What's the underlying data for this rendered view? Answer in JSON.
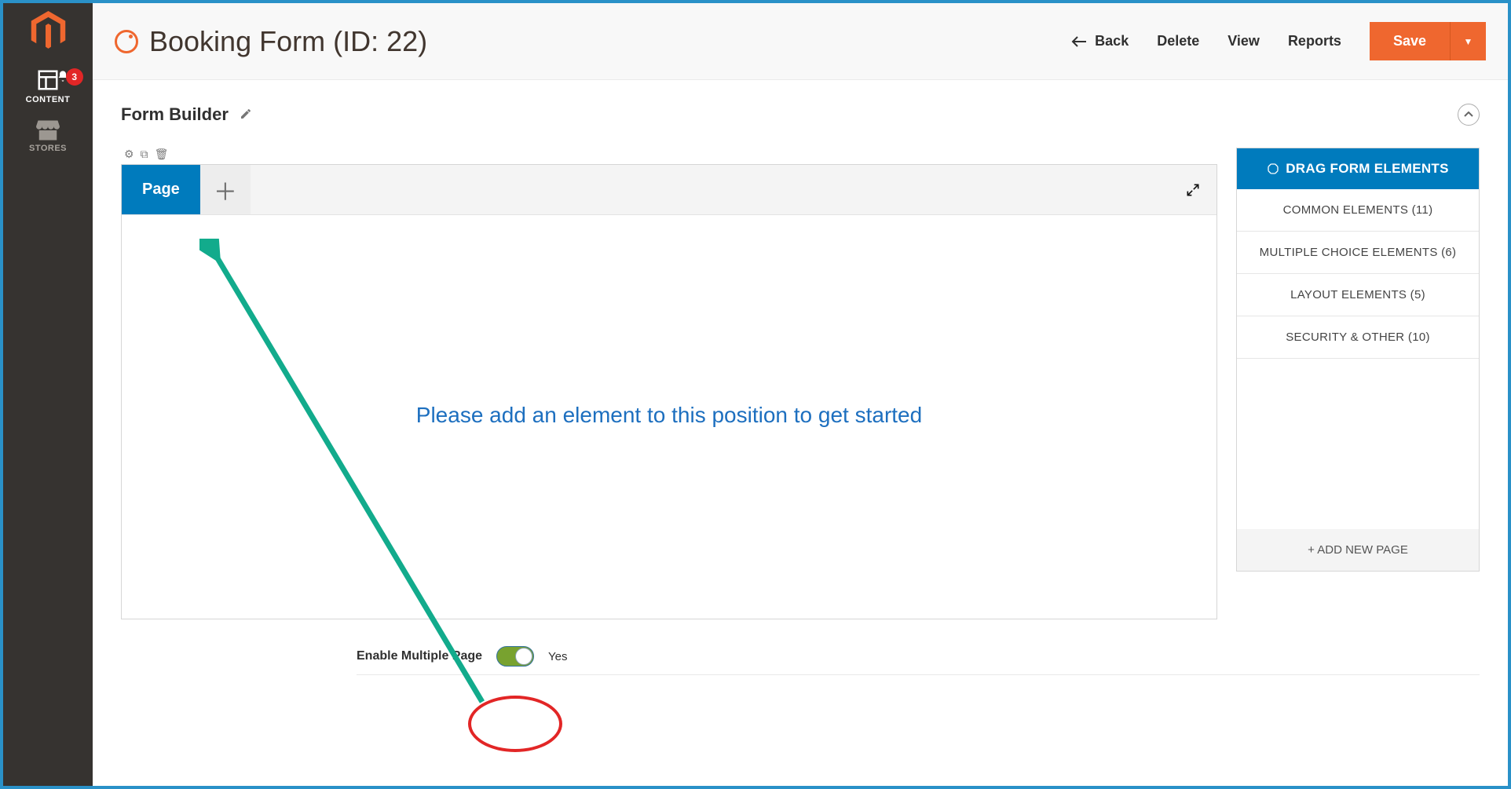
{
  "sidebar": {
    "items": [
      {
        "label": "CONTENT",
        "badge": "3"
      },
      {
        "label": "STORES"
      }
    ]
  },
  "header": {
    "title": "Booking Form (ID: 22)",
    "back": "Back",
    "delete": "Delete",
    "view": "View",
    "reports": "Reports",
    "save": "Save"
  },
  "builder": {
    "section_title": "Form Builder",
    "page_tab": "Page",
    "placeholder": "Please add an element to this position to get started"
  },
  "elements": {
    "header": "DRAG FORM ELEMENTS",
    "categories": [
      "COMMON ELEMENTS (11)",
      "MULTIPLE CHOICE ELEMENTS (6)",
      "LAYOUT ELEMENTS (5)",
      "SECURITY & OTHER (10)"
    ],
    "add_page": "+ ADD NEW PAGE"
  },
  "toggle": {
    "label": "Enable Multiple Page",
    "value": "Yes"
  }
}
